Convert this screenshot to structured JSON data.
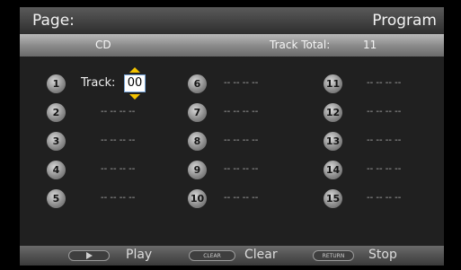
{
  "header": {
    "page_label": "Page:",
    "mode_label": "Program"
  },
  "subheader": {
    "disc": "CD",
    "track_total_label": "Track Total:",
    "track_total_value": "11"
  },
  "slots": [
    {
      "num": "1",
      "value": "",
      "editing": true
    },
    {
      "num": "2",
      "value": "-- -- -- --"
    },
    {
      "num": "3",
      "value": "-- -- -- --"
    },
    {
      "num": "4",
      "value": "-- -- -- --"
    },
    {
      "num": "5",
      "value": "-- -- -- --"
    },
    {
      "num": "6",
      "value": "-- -- -- --"
    },
    {
      "num": "7",
      "value": "-- -- -- --"
    },
    {
      "num": "8",
      "value": "-- -- -- --"
    },
    {
      "num": "9",
      "value": "-- -- -- --"
    },
    {
      "num": "10",
      "value": "-- -- -- --"
    },
    {
      "num": "11",
      "value": "-- -- -- --"
    },
    {
      "num": "12",
      "value": "-- -- -- --"
    },
    {
      "num": "13",
      "value": "-- -- -- --"
    },
    {
      "num": "14",
      "value": "-- -- -- --"
    },
    {
      "num": "15",
      "value": "-- -- -- --"
    }
  ],
  "editor": {
    "track_label": "Track:",
    "track_value": "00"
  },
  "footer": {
    "play_key": "play-key-icon",
    "play_label": "Play",
    "clear_key": "CLEAR",
    "clear_label": "Clear",
    "return_key": "RETURN",
    "stop_label": "Stop"
  },
  "colors": {
    "accent": "#f2c200",
    "panel": "#202020",
    "background": "#000000"
  }
}
